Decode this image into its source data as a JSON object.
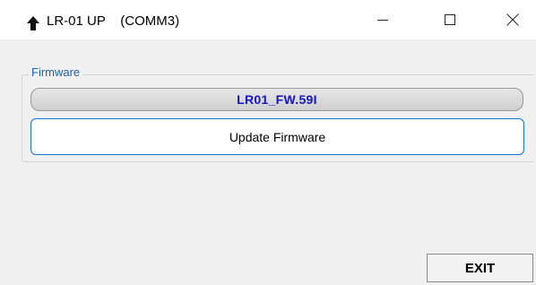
{
  "window": {
    "title": "LR-01 UP    (COMM3)",
    "icon": "up-arrow-icon",
    "controls": {
      "minimize": "minimize-icon",
      "maximize": "maximize-icon",
      "close": "close-icon"
    }
  },
  "firmware_group": {
    "label": "Firmware",
    "filename": "LR01_FW.59I",
    "update_button_label": "Update Firmware"
  },
  "footer": {
    "exit_label": "EXIT"
  },
  "colors": {
    "group_label": "#1a5fb4",
    "filename_text": "#1515c8",
    "update_button_border": "#1473d6",
    "client_background": "#f0f0f0"
  }
}
